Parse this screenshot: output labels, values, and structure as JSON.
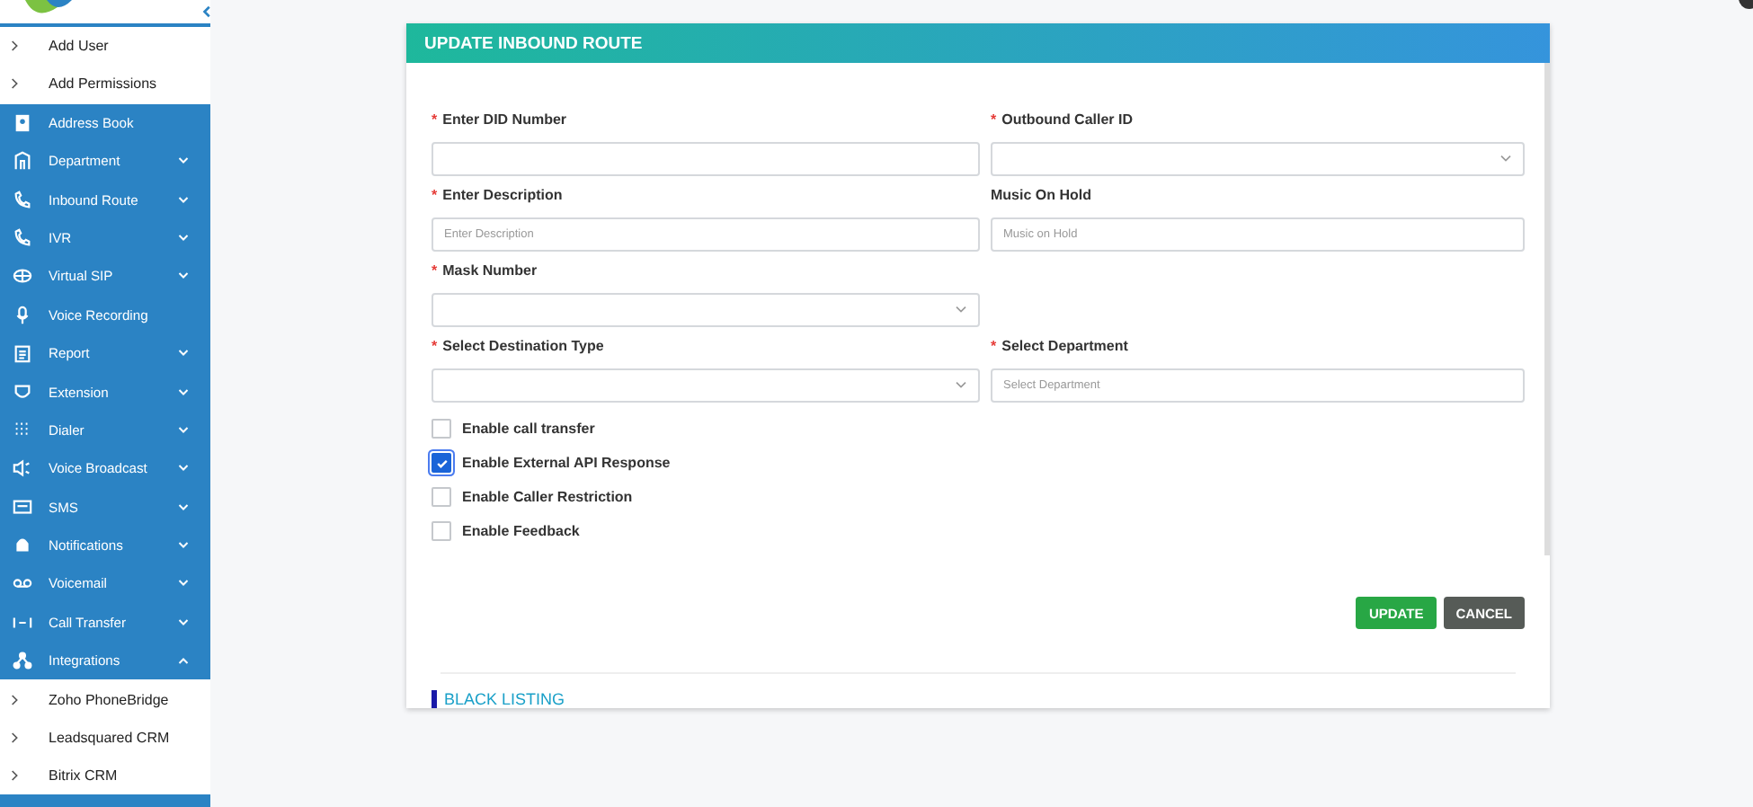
{
  "sidebar": {
    "items": [
      {
        "label": "Add User",
        "kind": "sub"
      },
      {
        "label": "Add Permissions",
        "kind": "sub"
      },
      {
        "label": "Address Book",
        "kind": "main"
      },
      {
        "label": "Department",
        "kind": "main",
        "expanded": false
      },
      {
        "label": "Inbound Route",
        "kind": "main",
        "expanded": false
      },
      {
        "label": "IVR",
        "kind": "main",
        "expanded": false
      },
      {
        "label": "Virtual SIP",
        "kind": "main",
        "expanded": false
      },
      {
        "label": "Voice Recording",
        "kind": "main"
      },
      {
        "label": "Report",
        "kind": "main",
        "expanded": false
      },
      {
        "label": "Extension",
        "kind": "main",
        "expanded": false
      },
      {
        "label": "Dialer",
        "kind": "main",
        "expanded": false
      },
      {
        "label": "Voice Broadcast",
        "kind": "main",
        "expanded": false
      },
      {
        "label": "SMS",
        "kind": "main",
        "expanded": false
      },
      {
        "label": "Notifications",
        "kind": "main",
        "expanded": false
      },
      {
        "label": "Voicemail",
        "kind": "main",
        "expanded": false
      },
      {
        "label": "Call Transfer",
        "kind": "main",
        "expanded": false
      },
      {
        "label": "Integrations",
        "kind": "main",
        "expanded": true
      },
      {
        "label": "Zoho PhoneBridge",
        "kind": "sub"
      },
      {
        "label": "Leadsquared CRM",
        "kind": "sub"
      },
      {
        "label": "Bitrix CRM",
        "kind": "sub"
      }
    ]
  },
  "form": {
    "title": "UPDATE INBOUND ROUTE",
    "rows": [
      [
        {
          "marker": "*",
          "label": "Enter DID Number",
          "kind": "text"
        },
        {
          "marker": "*",
          "label": "Outbound Caller ID",
          "kind": "select"
        }
      ],
      [
        {
          "marker": "*",
          "label": "Enter Description",
          "kind": "text",
          "placeholder": "Enter Description"
        },
        {
          "label": "Music On Hold",
          "kind": "text",
          "placeholder": "Music on Hold"
        }
      ],
      [
        {
          "marker": "*",
          "label": "Mask Number",
          "kind": "select"
        }
      ],
      [
        {
          "marker": "*",
          "label": "Select Destination Type",
          "kind": "select"
        },
        {
          "marker": "*",
          "label": "Select Department",
          "kind": "text",
          "placeholder": "Select Department"
        }
      ]
    ],
    "options": [
      {
        "label": "Enable call transfer",
        "checked": false
      },
      {
        "label": "Enable External API Response",
        "checked": true
      },
      {
        "label": "Enable Caller Restriction",
        "checked": false
      },
      {
        "label": "Enable Feedback",
        "checked": false
      }
    ],
    "buttons": [
      {
        "label": "UPDATE",
        "kind": "primary"
      },
      {
        "label": "CANCEL",
        "kind": "secondary"
      }
    ],
    "section_title": "BLACK LISTING"
  }
}
